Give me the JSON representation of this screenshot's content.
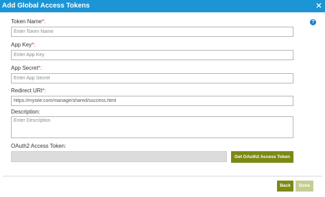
{
  "dialog": {
    "title": "Add Global Access Tokens",
    "close_icon": "close-icon",
    "help_icon": "?"
  },
  "form": {
    "token_name": {
      "label": "Token Name",
      "required_mark": "*:",
      "placeholder": "Enter Token Name",
      "value": ""
    },
    "app_key": {
      "label": "App Key",
      "required_mark": "*:",
      "placeholder": "Enter App Key",
      "value": ""
    },
    "app_secret": {
      "label": "App Secret",
      "required_mark": "*:",
      "placeholder": "Enter App Secret",
      "value": ""
    },
    "redirect_uri": {
      "label": "Redirect URI",
      "required_mark": "*:",
      "placeholder": "",
      "value": "https://mysite.com/manage/shared/success.html"
    },
    "description": {
      "label": "Description:",
      "placeholder": "Enter Description",
      "value": ""
    },
    "oauth_token": {
      "label": "OAuth2 Access Token:",
      "value": ""
    }
  },
  "buttons": {
    "get_token": "Get OAuth2 Access Token",
    "back": "Back",
    "done": "Done"
  },
  "colors": {
    "title_bar": "#1b95d6",
    "primary_button": "#7c8a14",
    "disabled_button": "#c5cd92",
    "required_mark": "#c0392b"
  }
}
